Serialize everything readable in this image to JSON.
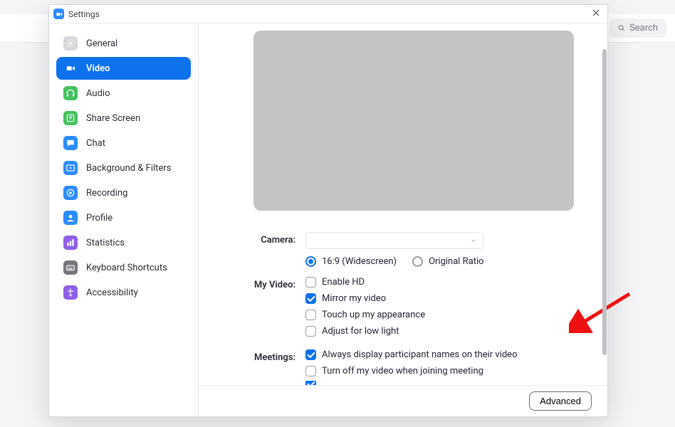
{
  "search": {
    "placeholder": "Search"
  },
  "window": {
    "title": "Settings",
    "advanced_button": "Advanced"
  },
  "sidebar": {
    "items": [
      {
        "label": "General",
        "icon": "gear-icon",
        "color": "#d8d8dc",
        "selected": false
      },
      {
        "label": "Video",
        "icon": "video-icon",
        "color": "#ffffff",
        "selected": true
      },
      {
        "label": "Audio",
        "icon": "headset-icon",
        "color": "#45c15e",
        "selected": false
      },
      {
        "label": "Share Screen",
        "icon": "share-icon",
        "color": "#45c15e",
        "selected": false
      },
      {
        "label": "Chat",
        "icon": "chat-icon",
        "color": "#2d8cff",
        "selected": false
      },
      {
        "label": "Background & Filters",
        "icon": "bg-icon",
        "color": "#2d8cff",
        "selected": false
      },
      {
        "label": "Recording",
        "icon": "recording-icon",
        "color": "#2d8cff",
        "selected": false
      },
      {
        "label": "Profile",
        "icon": "profile-icon",
        "color": "#2d8cff",
        "selected": false
      },
      {
        "label": "Statistics",
        "icon": "stats-icon",
        "color": "#8f5fe8",
        "selected": false
      },
      {
        "label": "Keyboard Shortcuts",
        "icon": "keyboard-icon",
        "color": "#76767e",
        "selected": false
      },
      {
        "label": "Accessibility",
        "icon": "accessibility-icon",
        "color": "#8f5fe8",
        "selected": false
      }
    ]
  },
  "form": {
    "camera_label": "Camera:",
    "myvideo_label": "My Video:",
    "meetings_label": "Meetings:",
    "aspect_options": [
      {
        "label": "16:9 (Widescreen)",
        "selected": true
      },
      {
        "label": "Original Ratio",
        "selected": false
      }
    ],
    "myvideo_options": [
      {
        "label": "Enable HD",
        "checked": false
      },
      {
        "label": "Mirror my video",
        "checked": true
      },
      {
        "label": "Touch up my appearance",
        "checked": false
      },
      {
        "label": "Adjust for low light",
        "checked": false
      }
    ],
    "meetings_options": [
      {
        "label": "Always display participant names on their video",
        "checked": true
      },
      {
        "label": "Turn off my video when joining meeting",
        "checked": false
      }
    ]
  }
}
